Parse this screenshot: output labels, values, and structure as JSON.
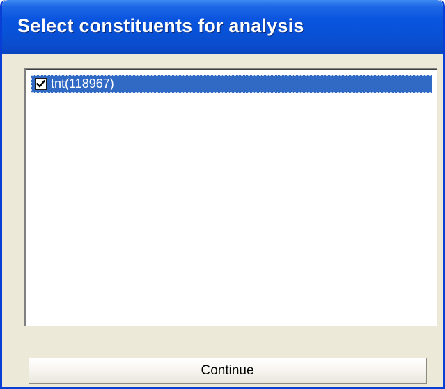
{
  "window": {
    "title": "Select constituents for analysis"
  },
  "list": {
    "items": [
      {
        "label": "tnt(118967)",
        "checked": true,
        "selected": true
      }
    ]
  },
  "buttons": {
    "continue_label": "Continue"
  },
  "colors": {
    "titlebar": "#0852d8",
    "selection": "#316ac5",
    "face": "#ece9d8"
  },
  "icons": {
    "check": "check-icon"
  }
}
